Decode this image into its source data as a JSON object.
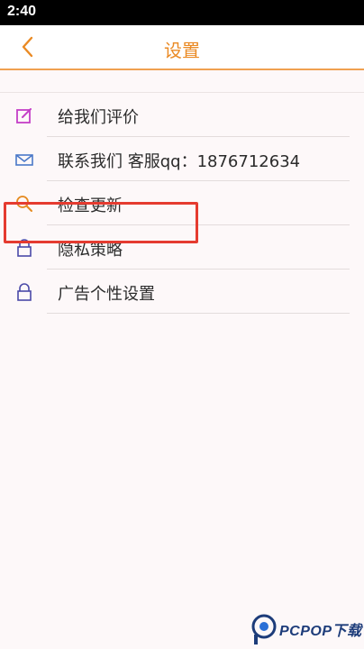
{
  "status_bar": {
    "time": "2:40"
  },
  "header": {
    "title": "设置",
    "back_icon": "chevron-left-icon",
    "accent_color": "#ea8a24"
  },
  "settings": {
    "items": [
      {
        "label": "给我们评价",
        "icon": "edit-icon",
        "icon_color": "#c43fc7"
      },
      {
        "label": "联系我们 客服qq：1876712634",
        "icon": "mail-icon",
        "icon_color": "#4a78c8"
      },
      {
        "label": "检查更新",
        "icon": "search-icon",
        "icon_color": "#e58a20"
      },
      {
        "label": "隐私策略",
        "icon": "lock-icon",
        "icon_color": "#4a4aa8"
      },
      {
        "label": "广告个性设置",
        "icon": "lock-icon",
        "icon_color": "#4a4aa8"
      }
    ],
    "highlight_color": "#e53b30"
  },
  "watermark": {
    "text": "PCPOP下载"
  }
}
